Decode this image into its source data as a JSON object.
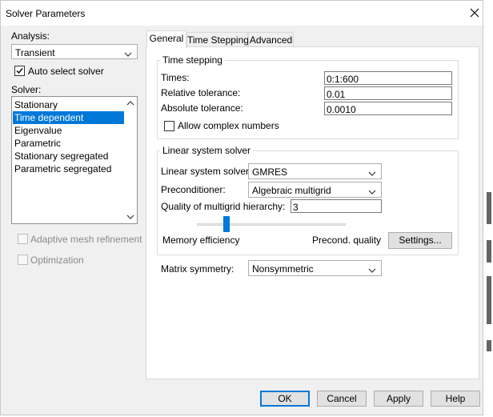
{
  "window": {
    "title": "Solver Parameters"
  },
  "left": {
    "analysis_label": "Analysis:",
    "analysis_value": "Transient",
    "auto_select_label": "Auto select solver",
    "auto_select_checked": true,
    "solver_label": "Solver:",
    "solvers": [
      {
        "label": "Stationary",
        "selected": false
      },
      {
        "label": "Time dependent",
        "selected": true
      },
      {
        "label": "Eigenvalue",
        "selected": false
      },
      {
        "label": "Parametric",
        "selected": false
      },
      {
        "label": "Stationary segregated",
        "selected": false
      },
      {
        "label": "Parametric segregated",
        "selected": false
      }
    ],
    "adaptive_label": "Adaptive mesh refinement",
    "optimization_label": "Optimization"
  },
  "tabs": [
    {
      "label": "General",
      "active": true
    },
    {
      "label": "Time Stepping",
      "active": false
    },
    {
      "label": "Advanced",
      "active": false
    }
  ],
  "time_stepping": {
    "title": "Time stepping",
    "times_label": "Times:",
    "times_value": "0:1:600",
    "rel_tol_label": "Relative tolerance:",
    "rel_tol_value": "0.01",
    "abs_tol_label": "Absolute tolerance:",
    "abs_tol_value": "0.0010",
    "complex_label": "Allow complex numbers",
    "complex_checked": false
  },
  "linear_solver": {
    "title": "Linear system solver",
    "solver_label": "Linear system solver:",
    "solver_value": "GMRES",
    "precond_label": "Preconditioner:",
    "precond_value": "Algebraic multigrid",
    "quality_label": "Quality of multigrid hierarchy:",
    "quality_value": "3",
    "slider_fraction": 0.2,
    "memory_label": "Memory efficiency",
    "precond_quality_label": "Precond. quality",
    "settings_label": "Settings..."
  },
  "matrix": {
    "label": "Matrix symmetry:",
    "value": "Nonsymmetric"
  },
  "buttons": {
    "ok": "OK",
    "cancel": "Cancel",
    "apply": "Apply",
    "help": "Help"
  },
  "colors": {
    "accent": "#0078d7",
    "dialog_bg": "#f0f0f0",
    "panel_bg": "#ffffff"
  }
}
